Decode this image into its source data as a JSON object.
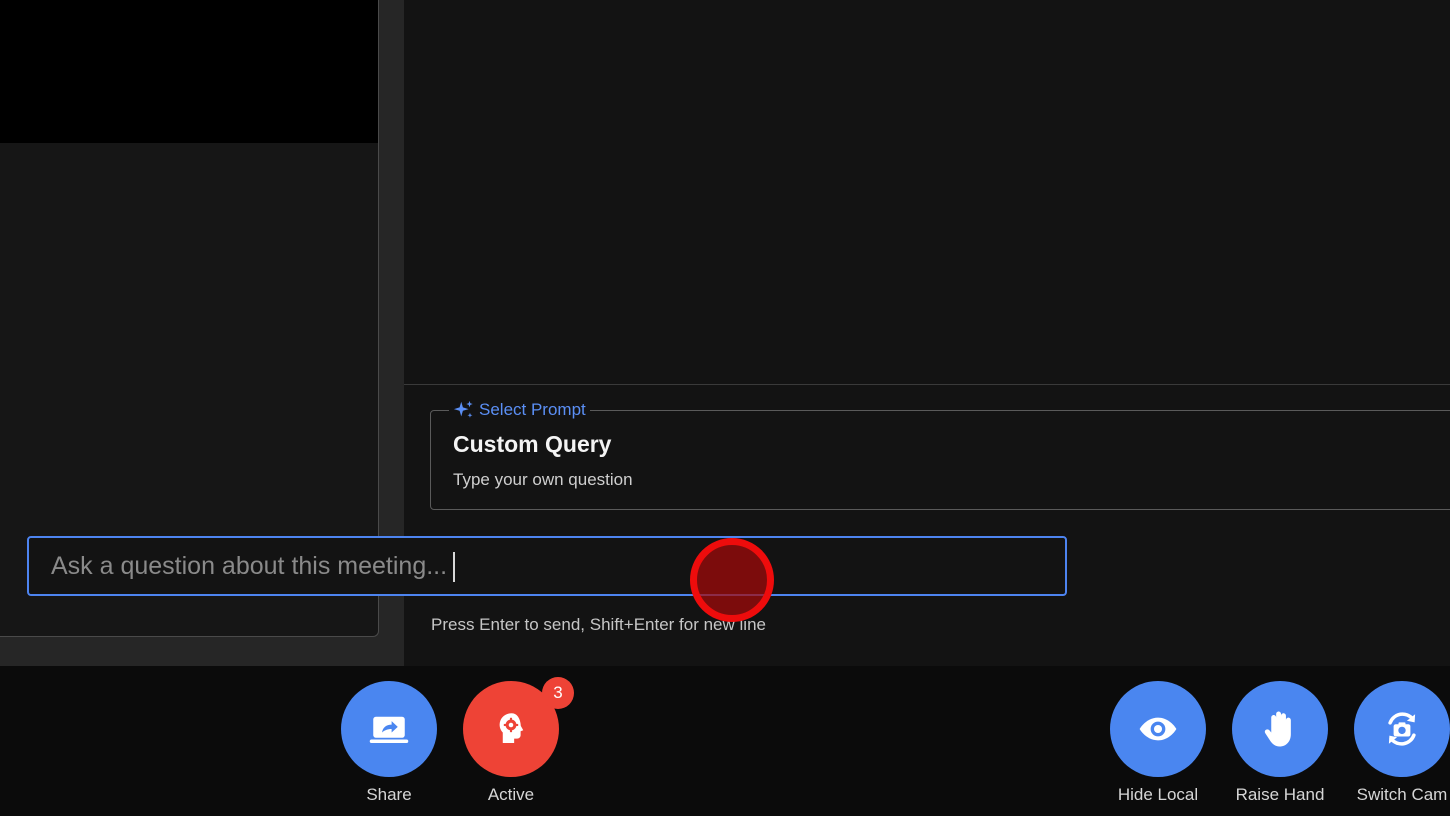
{
  "assistant": {
    "prompt_selector": {
      "legend": "Select Prompt",
      "selected_title": "Custom Query",
      "selected_description": "Type your own question"
    },
    "query": {
      "placeholder": "Ask a question about this meeting...",
      "value": ""
    },
    "hint": "Press Enter to send, Shift+Enter for new line"
  },
  "toolbar": {
    "share": {
      "label": "Share",
      "icon": "screen-share-icon"
    },
    "active": {
      "label": "Active",
      "icon": "ai-brain-icon",
      "badge": "3"
    },
    "hide_local": {
      "label": "Hide Local",
      "icon": "eye-icon"
    },
    "raise_hand": {
      "label": "Raise Hand",
      "icon": "hand-icon"
    },
    "switch_cam": {
      "label": "Switch Cam",
      "icon": "camera-switch-icon"
    }
  },
  "colors": {
    "accent_blue": "#4a86f0",
    "accent_red": "#ee4336",
    "panel_bg": "#131313",
    "focus_border": "#4d84f0"
  }
}
